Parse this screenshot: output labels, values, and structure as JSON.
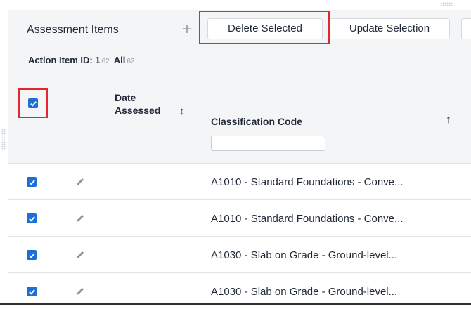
{
  "toolbar": {
    "title": "Assessment Items",
    "add_icon": "plus-icon",
    "delete_label": "Delete Selected",
    "update_label": "Update Selection"
  },
  "group": {
    "label": "Action Item ID:",
    "value": "1",
    "value_count": "62",
    "all_label": "All",
    "all_count": "62"
  },
  "table": {
    "columns": {
      "date_assessed": "Date Assessed",
      "classification_code": "Classification Code"
    },
    "filter_value": "",
    "rows": [
      {
        "checked": true,
        "date": "",
        "classification": "A1010 - Standard Foundations - Conve..."
      },
      {
        "checked": true,
        "date": "",
        "classification": "A1010 - Standard Foundations - Conve..."
      },
      {
        "checked": true,
        "date": "",
        "classification": "A1030 - Slab on Grade - Ground-level..."
      },
      {
        "checked": true,
        "date": "",
        "classification": "A1030 - Slab on Grade - Ground-level..."
      }
    ]
  },
  "colors": {
    "accent": "#1b6fd6",
    "highlight": "#e0282e",
    "panel_bg": "#f4f5f7"
  }
}
